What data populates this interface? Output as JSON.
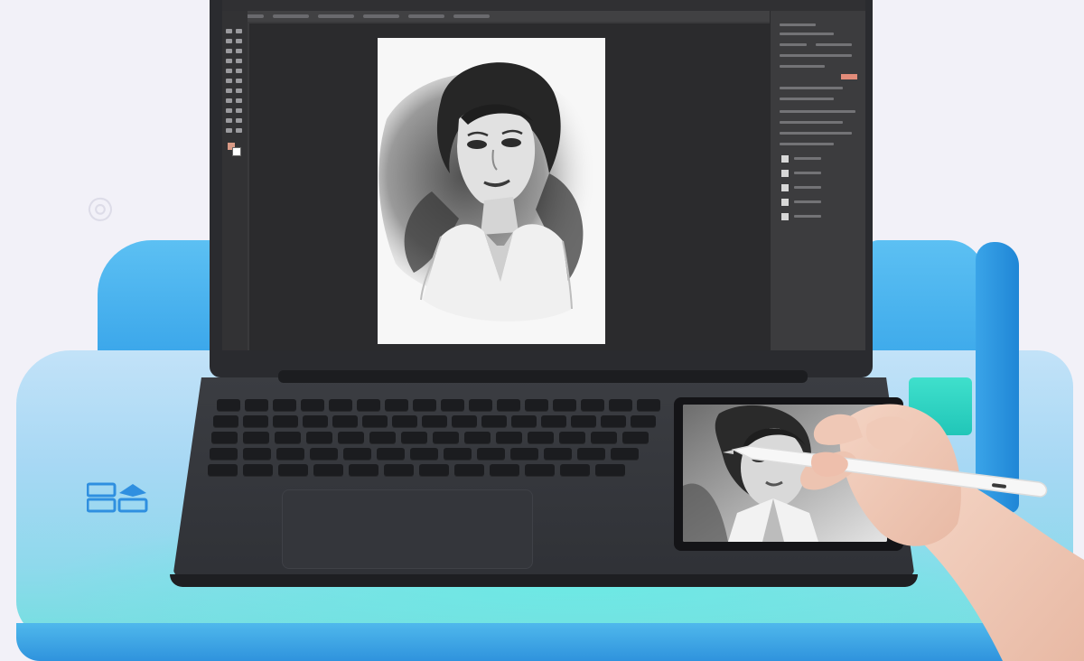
{
  "scene": {
    "description_tag": "",
    "colors": {
      "background": "#f2f1f8",
      "stand_blue": "#3aa6ea",
      "stand_top": "#a7d8f4",
      "stand_teal": "#21c6b8",
      "laptop_body": "#2f3136",
      "photoshop_panel": "#3c3c3e",
      "fg_swatch": "#d99a86"
    }
  },
  "laptop": {
    "screen_app": "image-editor",
    "document": "portrait-sketch"
  },
  "icons": {
    "stand_logo": "window-logo-icon",
    "stylus": "stylus-icon"
  }
}
